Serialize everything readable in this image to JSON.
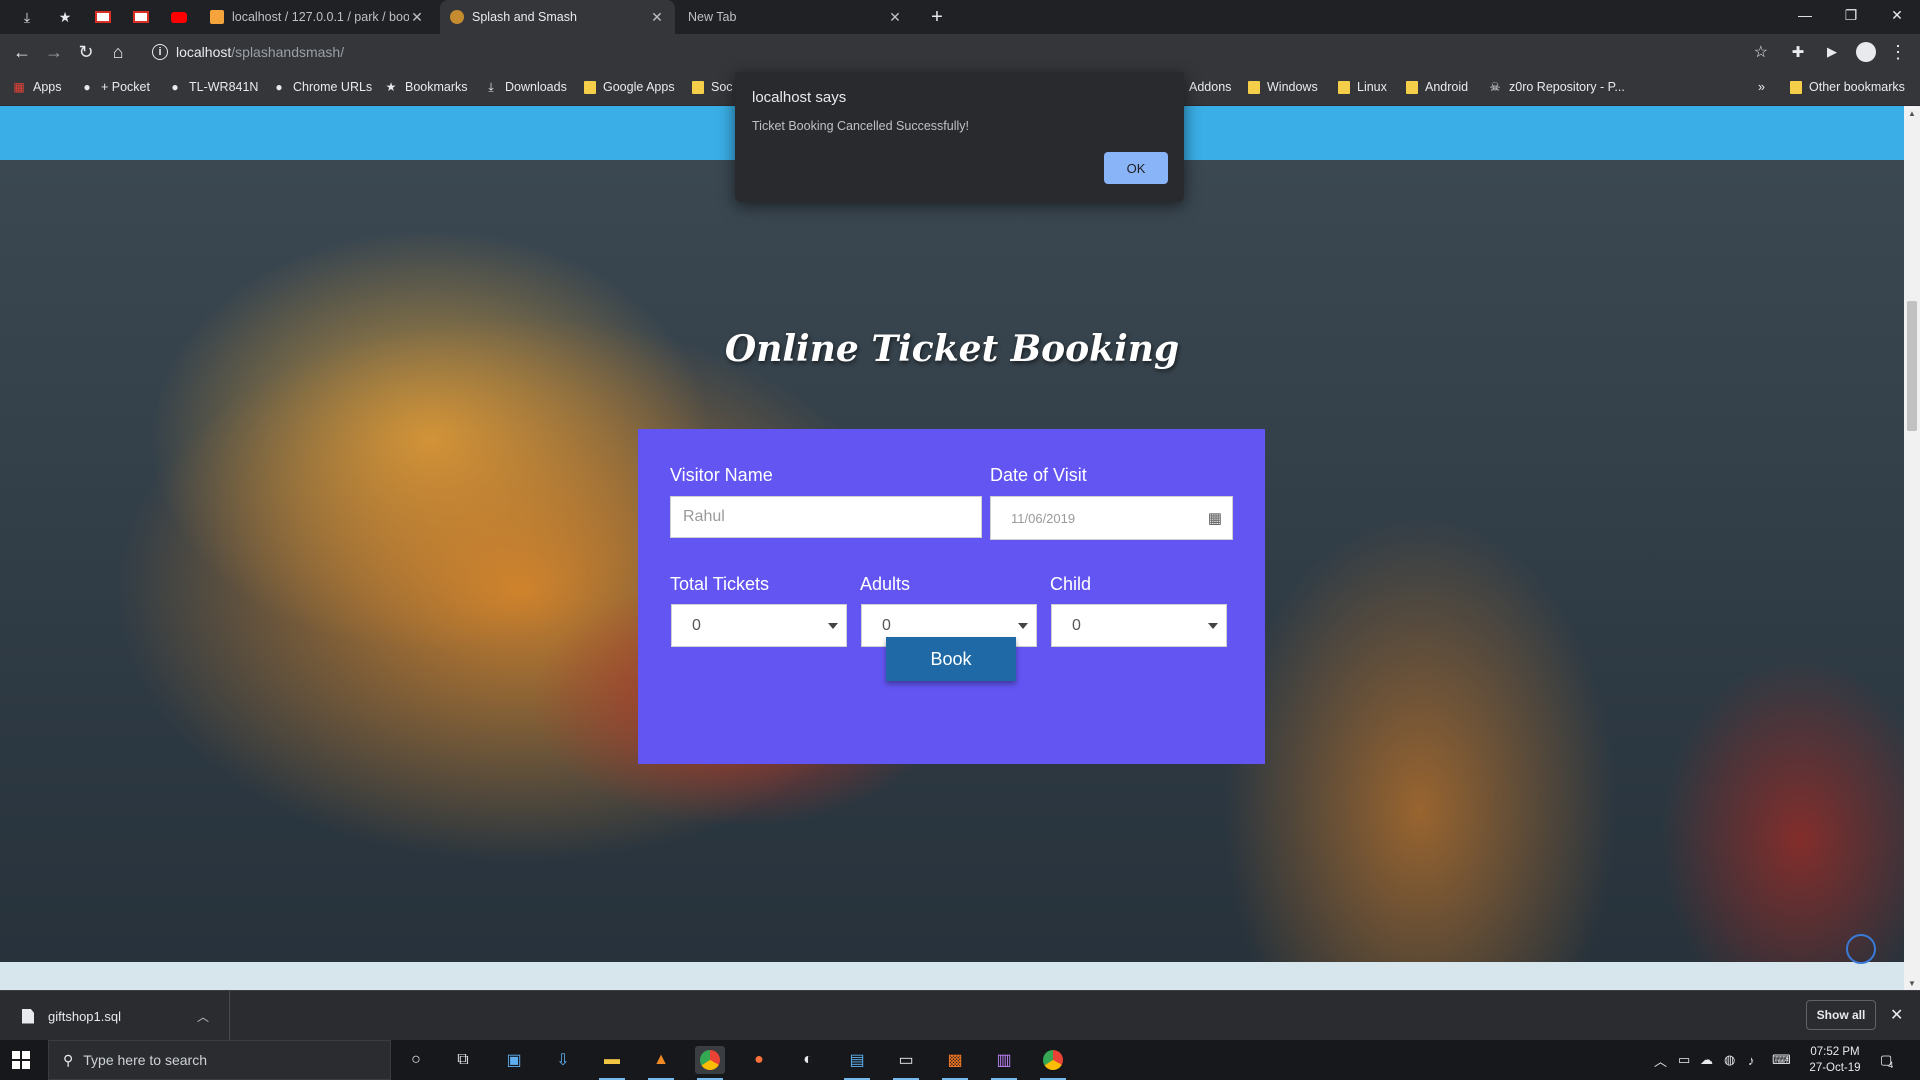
{
  "browser": {
    "tabs": [
      {
        "label": "localhost / 127.0.0.1 / park / boo",
        "active": false
      },
      {
        "label": "Splash and Smash",
        "active": true
      },
      {
        "label": "New Tab",
        "active": false
      }
    ],
    "new_tab_symbol": "+",
    "url_host": "localhost",
    "url_path": "/splashandsmash/",
    "bookmarks": [
      {
        "label": "Apps",
        "icon": "apps-grid-icon"
      },
      {
        "label": "+ Pocket",
        "icon": "globe-icon"
      },
      {
        "label": "TL-WR841N",
        "icon": "globe-icon"
      },
      {
        "label": "Chrome URLs",
        "icon": "globe-icon"
      },
      {
        "label": "Bookmarks",
        "icon": "star-icon"
      },
      {
        "label": "Downloads",
        "icon": "download-icon"
      },
      {
        "label": "Google Apps",
        "icon": "folder-icon"
      },
      {
        "label": "Soc",
        "icon": "folder-icon"
      },
      {
        "label": "Addons",
        "icon": "folder-icon"
      },
      {
        "label": "Windows",
        "icon": "folder-icon"
      },
      {
        "label": "Linux",
        "icon": "folder-icon"
      },
      {
        "label": "Android",
        "icon": "folder-icon"
      },
      {
        "label": "z0ro Repository - P...",
        "icon": "skull-icon"
      }
    ],
    "bookmarks_overflow": "»",
    "other_bookmarks": "Other bookmarks"
  },
  "page": {
    "heading": "Online Ticket Booking",
    "form": {
      "visitor_name_label": "Visitor Name",
      "visitor_name_value": "Rahul",
      "date_label": "Date of Visit",
      "date_value": "11/06/2019",
      "total_tickets_label": "Total Tickets",
      "total_tickets_value": "0",
      "adults_label": "Adults",
      "adults_value": "0",
      "child_label": "Child",
      "child_value": "0",
      "book_label": "Book"
    },
    "colors": {
      "top_band": "#3aaee6",
      "form_bg": "#6355f2",
      "book_button": "#1f6aa6"
    }
  },
  "alert": {
    "title": "localhost says",
    "message": "Ticket Booking Cancelled Successfully!",
    "ok_label": "OK"
  },
  "downloads": {
    "file_name": "giftshop1.sql",
    "show_all_label": "Show all"
  },
  "taskbar": {
    "search_placeholder": "Type here to search",
    "time": "07:52 PM",
    "date": "27-Oct-19",
    "notification_count": "4"
  }
}
